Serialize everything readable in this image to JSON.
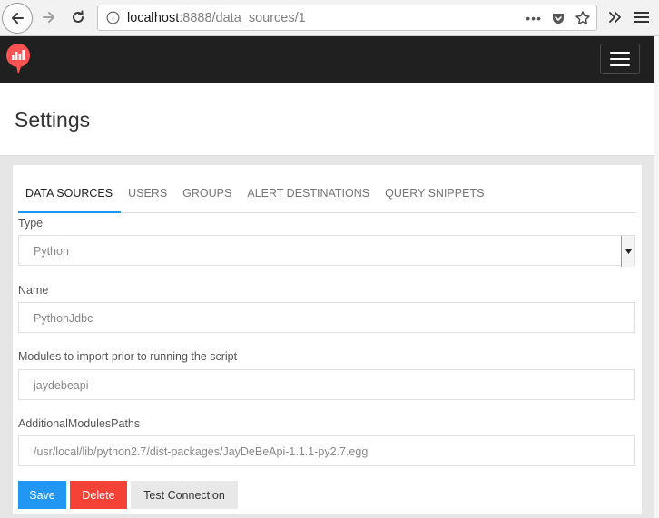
{
  "browser": {
    "url_host": "localhost",
    "url_rest": ":8888/data_sources/1"
  },
  "colors": {
    "accent": "#2196f3",
    "danger": "#f44336",
    "logo": "#ff5252",
    "header_bg": "#202020"
  },
  "page": {
    "title": "Settings"
  },
  "tabs": [
    {
      "label": "DATA SOURCES",
      "active": true
    },
    {
      "label": "USERS"
    },
    {
      "label": "GROUPS"
    },
    {
      "label": "ALERT DESTINATIONS"
    },
    {
      "label": "QUERY SNIPPETS"
    }
  ],
  "form": {
    "type_label": "Type",
    "type_value": "Python",
    "name_label": "Name",
    "name_value": "PythonJdbc",
    "modules_label": "Modules to import prior to running the script",
    "modules_value": "jaydebeapi",
    "paths_label": "AdditionalModulesPaths",
    "paths_value": "/usr/local/lib/python2.7/dist-packages/JayDeBeApi-1.1.1-py2.7.egg"
  },
  "actions": {
    "save": "Save",
    "delete": "Delete",
    "test": "Test Connection"
  }
}
